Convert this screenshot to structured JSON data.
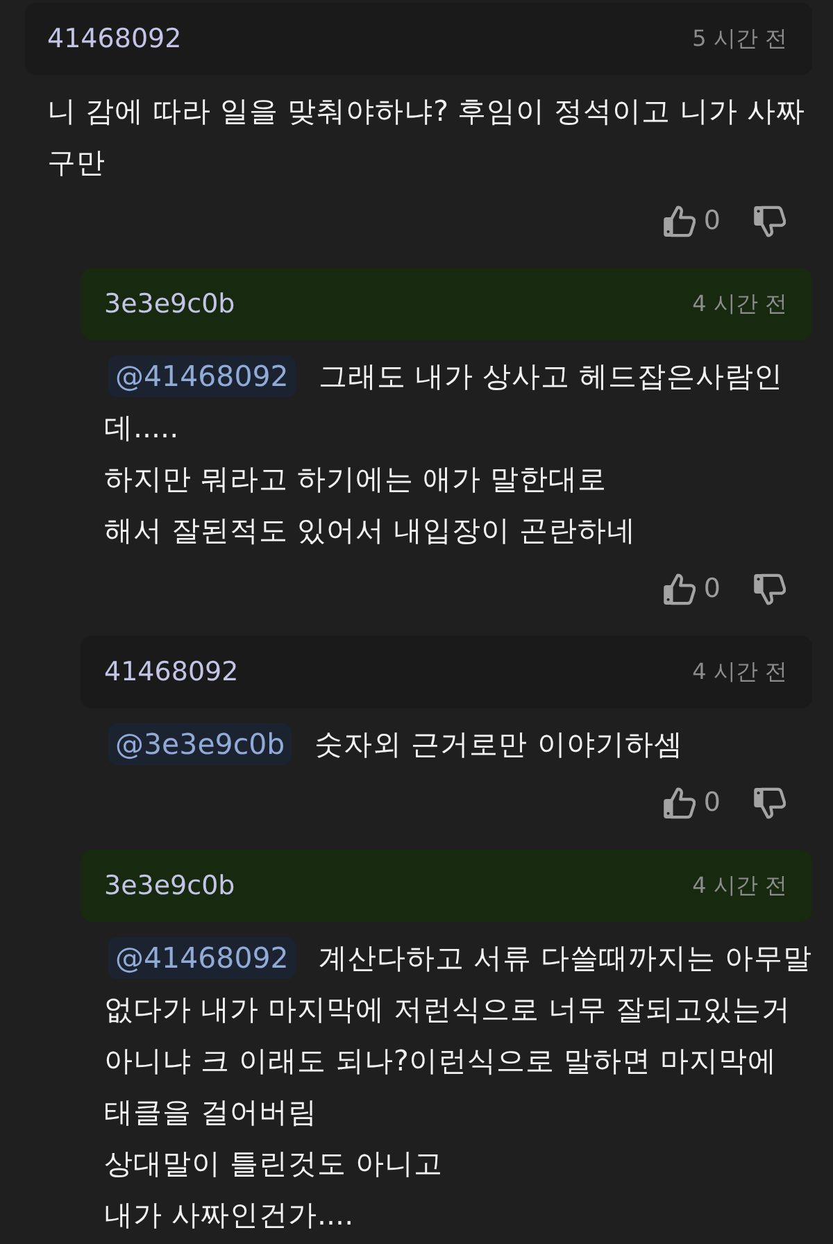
{
  "comments": [
    {
      "author": "41468092",
      "time": "5 시간 전",
      "highlighted": false,
      "body": "니 감에 따라 일을 맞춰야하냐? 후임이 정석이고 니가 사짜구만",
      "likes": "0",
      "replies": [
        {
          "author": "3e3e9c0b",
          "time": "4 시간 전",
          "highlighted": true,
          "mention": "@41468092",
          "body": "그래도 내가 상사고 헤드잡은사람인데.....\n하지만 뭐라고 하기에는 애가 말한대로\n해서 잘된적도 있어서 내입장이 곤란하네",
          "likes": "0"
        },
        {
          "author": "41468092",
          "time": "4 시간 전",
          "highlighted": false,
          "mention": "@3e3e9c0b",
          "body": "숫자외 근거로만 이야기하셈",
          "likes": "0"
        },
        {
          "author": "3e3e9c0b",
          "time": "4 시간 전",
          "highlighted": true,
          "mention": "@41468092",
          "body": "계산다하고 서류 다쓸때까지는 아무말없다가 내가 마지막에 저런식으로 너무 잘되고있는거아니냐 크 이래도 되나?이런식으로 말하면 마지막에 태클을 걸어버림\n상대말이 틀린것도 아니고\n내가 사짜인건가...."
        }
      ]
    }
  ]
}
